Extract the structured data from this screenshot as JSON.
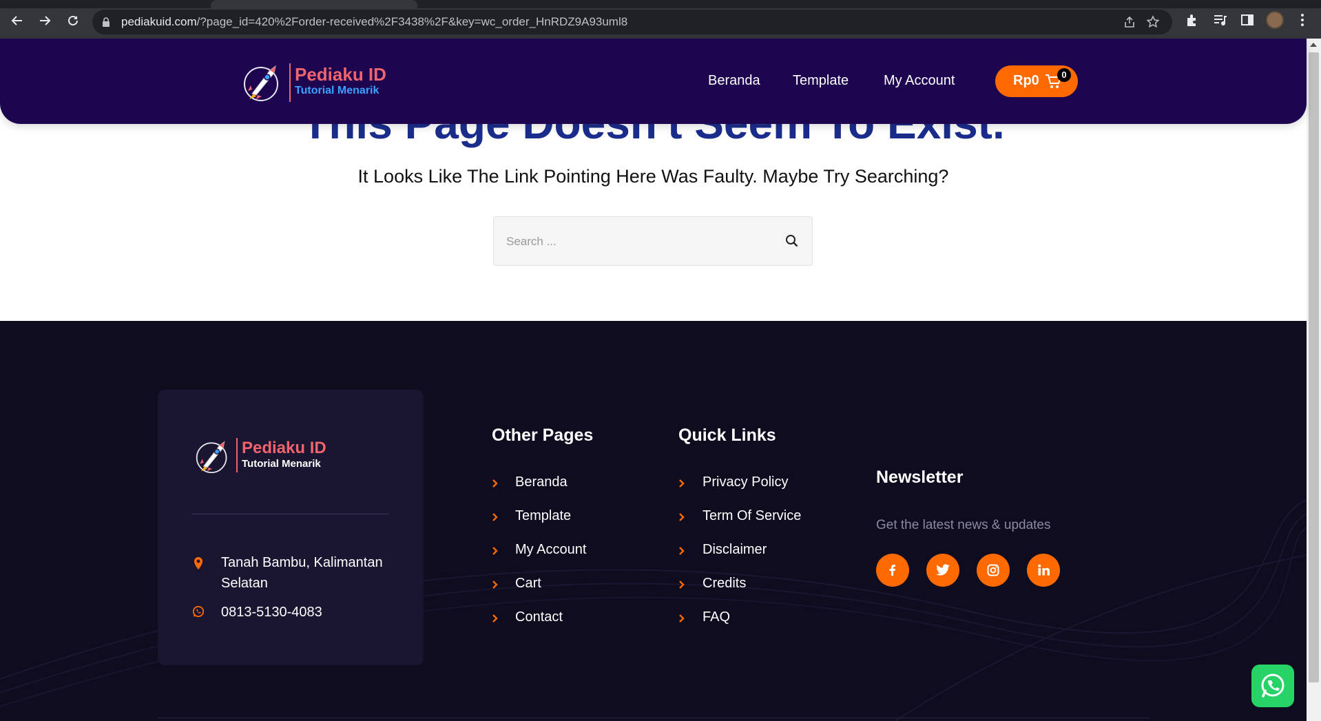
{
  "browser": {
    "url_host": "pediakuid.com",
    "url_path": "/?page_id=420%2Forder-received%2F3438%2F&key=wc_order_HnRDZ9A93uml8"
  },
  "header": {
    "logo_title": "Pediaku ID",
    "logo_subtitle": "Tutorial Menarik",
    "nav": [
      "Beranda",
      "Template",
      "My Account"
    ],
    "cart_amount": "Rp0",
    "cart_count": "0"
  },
  "error": {
    "title": "This Page Doesn't Seem To Exist.",
    "subtitle": "It Looks Like The Link Pointing Here Was Faulty. Maybe Try Searching?",
    "search_placeholder": "Search ..."
  },
  "footer": {
    "logo_title": "Pediaku ID",
    "logo_subtitle": "Tutorial Menarik",
    "address": "Tanah Bambu, Kalimantan Selatan",
    "phone": "0813-5130-4083",
    "other_pages": {
      "title": "Other Pages",
      "links": [
        "Beranda",
        "Template",
        "My Account",
        "Cart",
        "Contact"
      ]
    },
    "quick_links": {
      "title": "Quick Links",
      "links": [
        "Privacy Policy",
        "Term Of Service",
        "Disclaimer",
        "Credits",
        "FAQ"
      ]
    },
    "newsletter": {
      "title": "Newsletter",
      "description": "Get the latest news & updates"
    },
    "social": [
      "facebook-icon",
      "twitter-icon",
      "instagram-icon",
      "linkedin-icon"
    ]
  },
  "colors": {
    "header_bg": "#1d0550",
    "accent": "#ff6a00",
    "title_blue": "#1b2d8c",
    "footer_bg": "#0f0c1f",
    "whatsapp": "#25d366"
  }
}
